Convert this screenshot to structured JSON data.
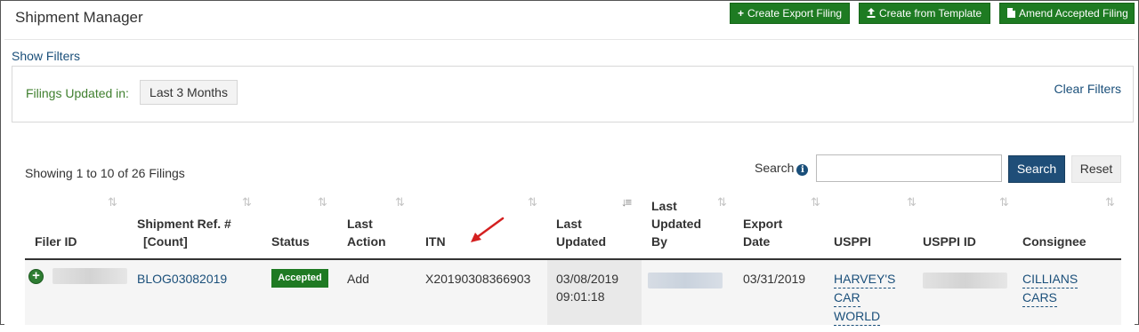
{
  "app": {
    "title": "Shipment Manager"
  },
  "header_buttons": {
    "create_export": {
      "icon": "plus-icon",
      "label": "Create Export Filing"
    },
    "create_template": {
      "icon": "upload-icon",
      "label": "Create from Template"
    },
    "amend": {
      "icon": "document-icon",
      "label": "Amend Accepted Filing"
    }
  },
  "filters": {
    "toggle_label": "Show Filters",
    "updated_in_label": "Filings Updated in:",
    "updated_in_value": "Last 3 Months",
    "clear_label": "Clear Filters"
  },
  "listing": {
    "showing_text": "Showing 1 to 10 of 26 Filings",
    "search_label": "Search",
    "search_value": "",
    "search_button": "Search",
    "reset_button": "Reset"
  },
  "table": {
    "columns": [
      {
        "key": "filer_id",
        "label": "Filer ID"
      },
      {
        "key": "shipment_ref",
        "label_line1": "Shipment Ref. #",
        "label_line2": "[Count]"
      },
      {
        "key": "status",
        "label": "Status"
      },
      {
        "key": "last_action",
        "label_line1": "Last",
        "label_line2": "Action"
      },
      {
        "key": "itn",
        "label": "ITN"
      },
      {
        "key": "last_updated",
        "label_line1": "Last",
        "label_line2": "Updated"
      },
      {
        "key": "last_updated_by",
        "label_line1": "Last",
        "label_line2": "Updated",
        "label_line3": "By"
      },
      {
        "key": "export_date",
        "label_line1": "Export",
        "label_line2": "Date"
      },
      {
        "key": "usppi",
        "label": "USPPI"
      },
      {
        "key": "usppi_id",
        "label": "USPPI ID"
      },
      {
        "key": "consignee",
        "label": "Consignee"
      }
    ],
    "rows": [
      {
        "shipment_ref": "BLOG03082019",
        "status": "Accepted",
        "last_action": "Add",
        "itn": "X20190308366903",
        "last_updated_date": "03/08/2019",
        "last_updated_time": "09:01:18",
        "export_date": "03/31/2019",
        "usppi_lines": [
          "HARVEY'S",
          "CAR",
          "WORLD"
        ],
        "consignee_lines": [
          "CILLIANS",
          "CARS"
        ]
      }
    ]
  },
  "colors": {
    "primary_green": "#1e7b22",
    "link_blue": "#1a4f7a",
    "search_button": "#1f4e78",
    "annotation_arrow": "#d42020"
  }
}
